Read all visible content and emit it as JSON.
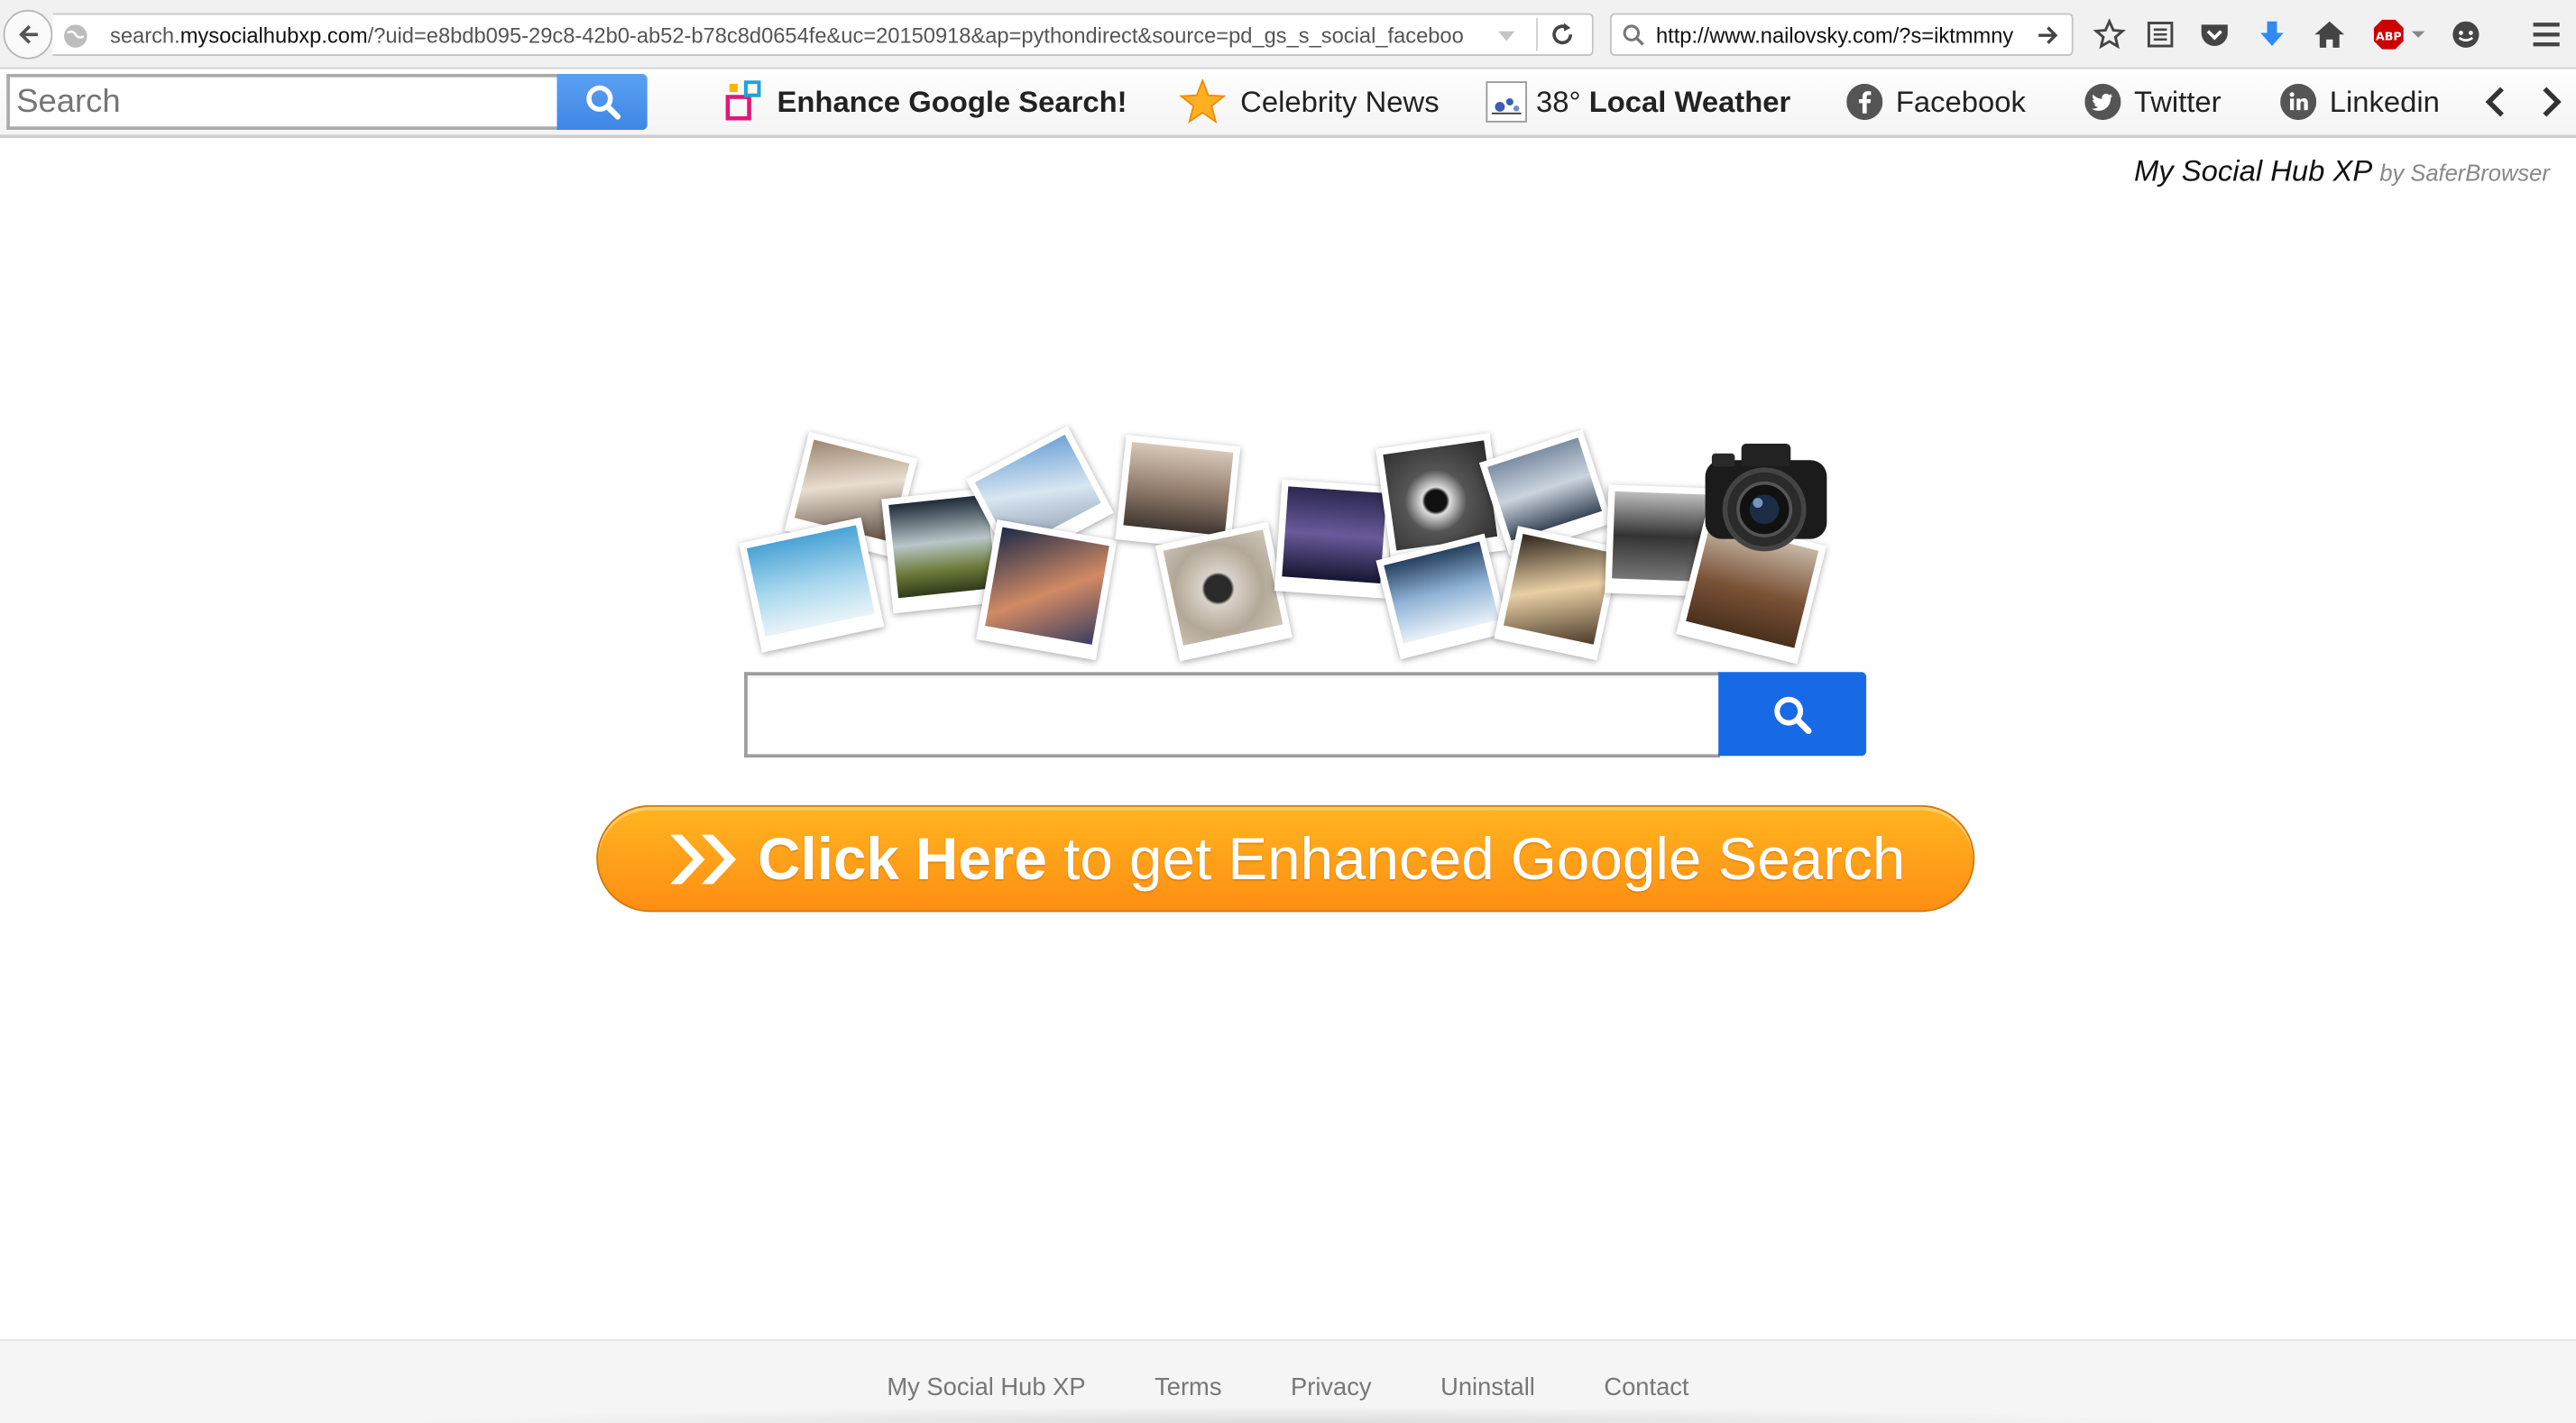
{
  "browser": {
    "url_prefix": "search.",
    "url_host": "mysocialhubxp.com",
    "url_rest": "/?uid=e8bdb095-29c8-42b0-ab52-b78c8d0654fe&uc=20150918&ap=pythondirect&source=pd_gs_s_social_faceboo",
    "search_value": "http://www.nailovsky.com/?s=iktmmny",
    "icons": [
      "back-icon",
      "globe-icon",
      "dropdown-icon",
      "reload-icon",
      "search-icon",
      "go-arrow-icon",
      "bookmark-star-icon",
      "reading-list-icon",
      "pocket-icon",
      "download-icon",
      "home-icon",
      "adblock-icon",
      "chat-icon",
      "menu-icon"
    ],
    "adblock_label": "ABP"
  },
  "toolbar": {
    "search_placeholder": "Search",
    "enhance_label": "Enhance Google Search!",
    "celebrity_label": "Celebrity News",
    "weather_temp": "38°",
    "weather_label": "Local Weather",
    "facebook_label": "Facebook",
    "twitter_label": "Twitter",
    "linkedin_label": "Linkedin"
  },
  "brand": {
    "name": "My Social Hub XP",
    "by": "by SaferBrowser"
  },
  "main": {
    "search_value": "",
    "cta_strong": "Click Here",
    "cta_rest": " to get Enhanced Google Search",
    "cta_color": "#ffa11a",
    "search_button_color": "#1769e6"
  },
  "footer": {
    "links": [
      "My Social Hub XP",
      "Terms",
      "Privacy",
      "Uninstall",
      "Contact"
    ]
  }
}
